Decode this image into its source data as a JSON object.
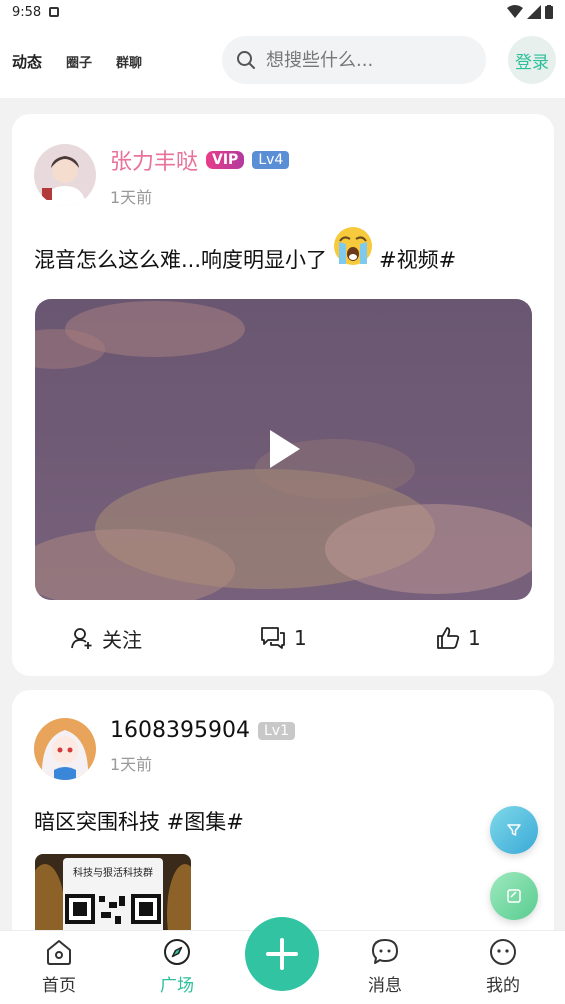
{
  "status_bar": {
    "time": "9:58"
  },
  "header": {
    "tabs": [
      {
        "label": "动态",
        "active": true
      },
      {
        "label": "圈子",
        "active": false
      },
      {
        "label": "群聊",
        "active": false
      }
    ],
    "search_placeholder": "想搜些什么...",
    "login_label": "登录"
  },
  "posts": [
    {
      "author": "张力丰哒",
      "vip_badge": "VIP",
      "level": "Lv4",
      "time": "1天前",
      "text_before_emoji": "混音怎么这么难...响度明显小了",
      "text_after_emoji": "#视频#",
      "follow_label": "关注",
      "comments": "1",
      "likes": "1"
    },
    {
      "author": "1608395904",
      "level": "Lv1",
      "time": "1天前",
      "text": "暗区突围科技 #图集#",
      "image_caption": "科技与狠活科技群"
    }
  ],
  "bottom_nav": {
    "items": [
      {
        "label": "首页",
        "icon": "home-icon"
      },
      {
        "label": "广场",
        "icon": "compass-icon",
        "active": true
      },
      {
        "label": "消息",
        "icon": "message-icon"
      },
      {
        "label": "我的",
        "icon": "profile-icon"
      }
    ]
  },
  "colors": {
    "accent": "#32c4a2",
    "vip_name": "#e8729a",
    "level_badge": "#5a8fd6"
  }
}
